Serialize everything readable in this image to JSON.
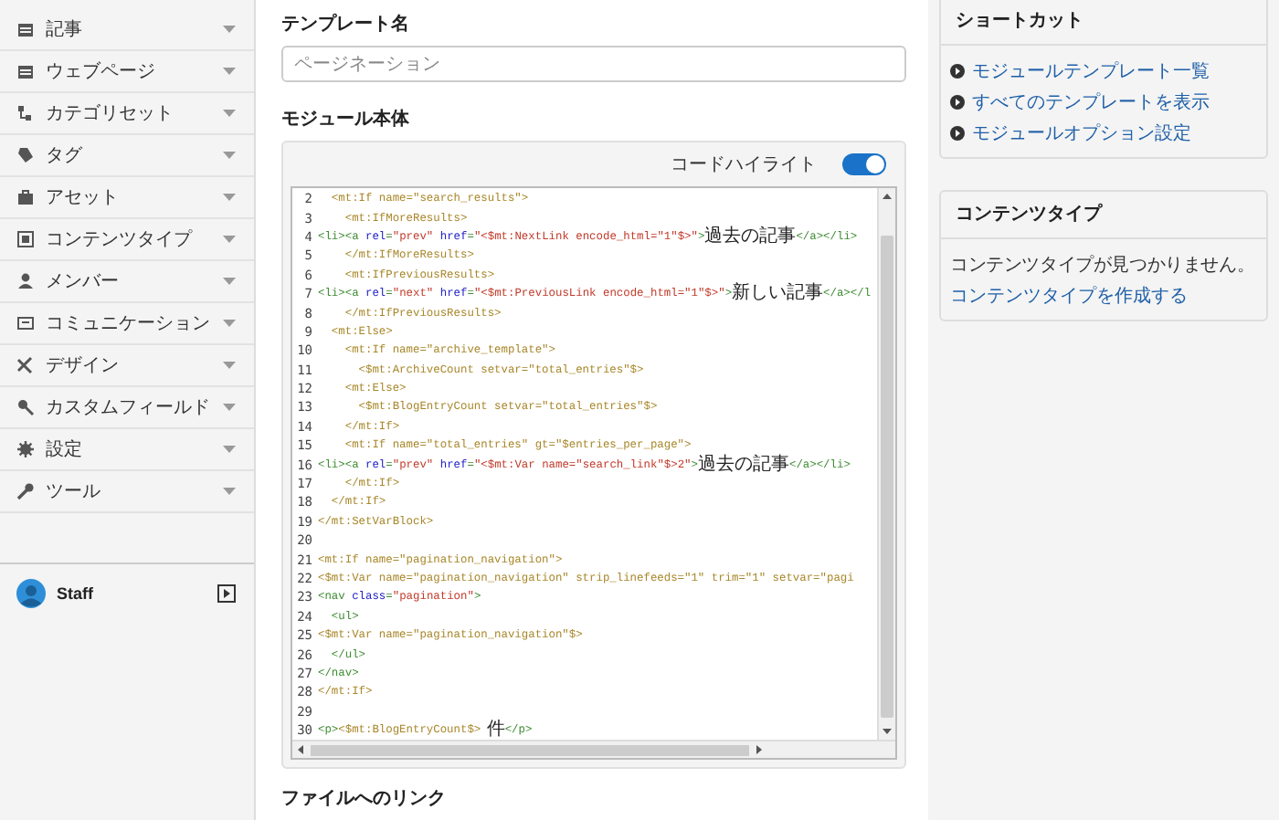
{
  "sidebar": {
    "items": [
      {
        "label": "記事"
      },
      {
        "label": "ウェブページ"
      },
      {
        "label": "カテゴリセット"
      },
      {
        "label": "タグ"
      },
      {
        "label": "アセット"
      },
      {
        "label": "コンテンツタイプ"
      },
      {
        "label": "メンバー"
      },
      {
        "label": "コミュニケーション"
      },
      {
        "label": "デザイン"
      },
      {
        "label": "カスタムフィールド"
      },
      {
        "label": "設定"
      },
      {
        "label": "ツール"
      }
    ],
    "user": {
      "name": "Staff"
    }
  },
  "template_name": {
    "label": "テンプレート名",
    "placeholder": "ページネーション"
  },
  "module_body": {
    "label": "モジュール本体",
    "highlight": {
      "label": "コードハイライト",
      "on": true
    },
    "lines": [
      {
        "n": "2",
        "tokens": [
          {
            "kind": "mt",
            "text": "  <mt:If name=\"search_results\">"
          }
        ]
      },
      {
        "n": "3",
        "tokens": [
          {
            "kind": "mt",
            "text": "    <mt:IfMoreResults>"
          }
        ]
      },
      {
        "n": "4",
        "tokens": [
          {
            "kind": "tag",
            "text": "<li><a "
          },
          {
            "kind": "attr",
            "text": "rel"
          },
          {
            "kind": "tag",
            "text": "="
          },
          {
            "kind": "str",
            "text": "\"prev\""
          },
          {
            "kind": "attr",
            "text": " href"
          },
          {
            "kind": "tag",
            "text": "="
          },
          {
            "kind": "str",
            "text": "\"<$mt:NextLink encode_html=\"1\"$>\""
          },
          {
            "kind": "tag",
            "text": ">"
          },
          {
            "kind": "text",
            "text": "過去の記事"
          },
          {
            "kind": "tag",
            "text": "</a></li>"
          }
        ]
      },
      {
        "n": "5",
        "tokens": [
          {
            "kind": "mt",
            "text": "    </mt:IfMoreResults>"
          }
        ]
      },
      {
        "n": "6",
        "tokens": [
          {
            "kind": "mt",
            "text": "    <mt:IfPreviousResults>"
          }
        ]
      },
      {
        "n": "7",
        "tokens": [
          {
            "kind": "tag",
            "text": "<li><a "
          },
          {
            "kind": "attr",
            "text": "rel"
          },
          {
            "kind": "tag",
            "text": "="
          },
          {
            "kind": "str",
            "text": "\"next\""
          },
          {
            "kind": "attr",
            "text": " href"
          },
          {
            "kind": "tag",
            "text": "="
          },
          {
            "kind": "str",
            "text": "\"<$mt:PreviousLink encode_html=\"1\"$>\""
          },
          {
            "kind": "tag",
            "text": ">"
          },
          {
            "kind": "text",
            "text": "新しい記事"
          },
          {
            "kind": "tag",
            "text": "</a></l"
          }
        ]
      },
      {
        "n": "8",
        "tokens": [
          {
            "kind": "mt",
            "text": "    </mt:IfPreviousResults>"
          }
        ]
      },
      {
        "n": "9",
        "tokens": [
          {
            "kind": "mt",
            "text": "  <mt:Else>"
          }
        ]
      },
      {
        "n": "10",
        "tokens": [
          {
            "kind": "mt",
            "text": "    <mt:If name=\"archive_template\">"
          }
        ]
      },
      {
        "n": "11",
        "tokens": [
          {
            "kind": "mt",
            "text": "      <$mt:ArchiveCount setvar=\"total_entries\"$>"
          }
        ]
      },
      {
        "n": "12",
        "tokens": [
          {
            "kind": "mt",
            "text": "    <mt:Else>"
          }
        ]
      },
      {
        "n": "13",
        "tokens": [
          {
            "kind": "mt",
            "text": "      <$mt:BlogEntryCount setvar=\"total_entries\"$>"
          }
        ]
      },
      {
        "n": "14",
        "tokens": [
          {
            "kind": "mt",
            "text": "    </mt:If>"
          }
        ]
      },
      {
        "n": "15",
        "tokens": [
          {
            "kind": "mt",
            "text": "    <mt:If name=\"total_entries\" gt=\"$entries_per_page\">"
          }
        ]
      },
      {
        "n": "16",
        "tokens": [
          {
            "kind": "tag",
            "text": "<li><a "
          },
          {
            "kind": "attr",
            "text": "rel"
          },
          {
            "kind": "tag",
            "text": "="
          },
          {
            "kind": "str",
            "text": "\"prev\""
          },
          {
            "kind": "attr",
            "text": " href"
          },
          {
            "kind": "tag",
            "text": "="
          },
          {
            "kind": "str",
            "text": "\"<$mt:Var name=\"search_link\"$>2\""
          },
          {
            "kind": "tag",
            "text": ">"
          },
          {
            "kind": "text",
            "text": "過去の記事"
          },
          {
            "kind": "tag",
            "text": "</a></li>"
          }
        ]
      },
      {
        "n": "17",
        "tokens": [
          {
            "kind": "mt",
            "text": "    </mt:If>"
          }
        ]
      },
      {
        "n": "18",
        "tokens": [
          {
            "kind": "mt",
            "text": "  </mt:If>"
          }
        ]
      },
      {
        "n": "19",
        "tokens": [
          {
            "kind": "mt",
            "text": "</mt:SetVarBlock>"
          }
        ]
      },
      {
        "n": "20"
      },
      {
        "n": "21",
        "tokens": [
          {
            "kind": "mt",
            "text": "<mt:If name=\"pagination_navigation\">"
          }
        ]
      },
      {
        "n": "22",
        "tokens": [
          {
            "kind": "mt",
            "text": "<$mt:Var name=\"pagination_navigation\" strip_linefeeds=\"1\" trim=\"1\" setvar=\"pagi"
          }
        ]
      },
      {
        "n": "23",
        "tokens": [
          {
            "kind": "tag",
            "text": "<nav "
          },
          {
            "kind": "attr",
            "text": "class"
          },
          {
            "kind": "tag",
            "text": "="
          },
          {
            "kind": "str",
            "text": "\"pagination\""
          },
          {
            "kind": "tag",
            "text": ">"
          }
        ]
      },
      {
        "n": "24",
        "tokens": [
          {
            "kind": "tag",
            "text": "  <ul>"
          }
        ]
      },
      {
        "n": "25",
        "tokens": [
          {
            "kind": "mt",
            "text": "<$mt:Var name=\"pagination_navigation\"$>"
          }
        ]
      },
      {
        "n": "26",
        "tokens": [
          {
            "kind": "tag",
            "text": "  </ul>"
          }
        ]
      },
      {
        "n": "27",
        "tokens": [
          {
            "kind": "tag",
            "text": "</nav>"
          }
        ]
      },
      {
        "n": "28",
        "tokens": [
          {
            "kind": "mt",
            "text": "</mt:If>"
          }
        ]
      },
      {
        "n": "29"
      },
      {
        "n": "30",
        "tokens": [
          {
            "kind": "tag",
            "text": "<p>"
          },
          {
            "kind": "mt",
            "text": "<$mt:BlogEntryCount$>"
          },
          {
            "kind": "text",
            "text": " 件"
          },
          {
            "kind": "tag",
            "text": "</p>"
          }
        ]
      }
    ]
  },
  "file_link": {
    "label": "ファイルへのリンク"
  },
  "shortcuts": {
    "title": "ショートカット",
    "links": [
      "モジュールテンプレート一覧",
      "すべてのテンプレートを表示",
      "モジュールオプション設定"
    ]
  },
  "content_types": {
    "title": "コンテンツタイプ",
    "message": "コンテンツタイプが見つかりません。",
    "link": "コンテンツタイプを作成する"
  }
}
